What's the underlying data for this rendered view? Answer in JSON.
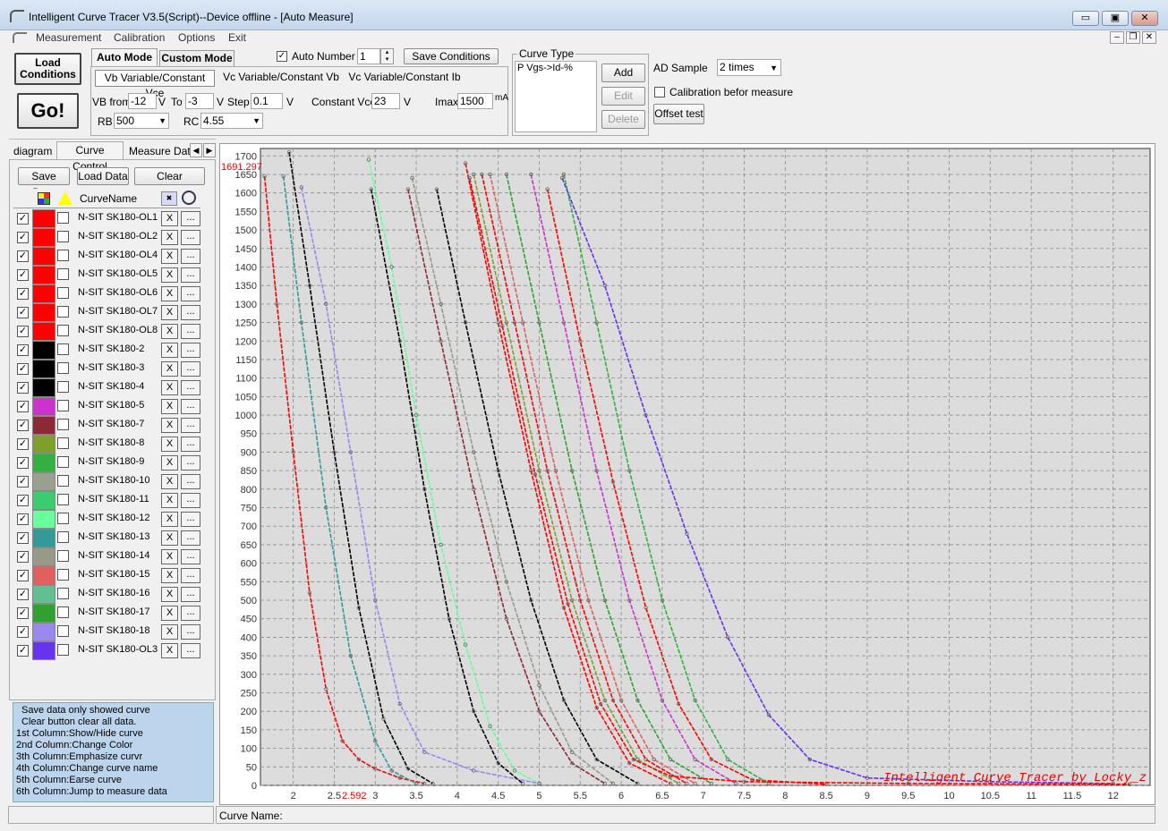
{
  "window": {
    "title": "Intelligent Curve Tracer V3.5(Script)--Device offline - [Auto Measure]",
    "min_label": "▭",
    "max_label": "▣",
    "close_label": "✕"
  },
  "menu": [
    "Measurement",
    "Calibration",
    "Options",
    "Exit"
  ],
  "toolbar": {
    "load_conditions": "Load Conditions",
    "go": "Go!",
    "auto_mode": "Auto Mode",
    "custom_mode": "Custom Mode",
    "auto_number_label": "Auto Number",
    "auto_number_value": "1",
    "save_conditions": "Save Conditions",
    "tabs": [
      "Vb Variable/Constant Vce",
      "Vc Variable/Constant Vb",
      "Vc Variable/Constant Ib"
    ],
    "vb_from_label": "VB from",
    "vb_from": "-12",
    "v1": "V",
    "to_label": "To",
    "to_value": "-3",
    "v2": "V",
    "step_label": "Step",
    "step_value": "0.1",
    "v3": "V",
    "const_vce_label": "Constant Vce",
    "const_vce": "23",
    "v4": "V",
    "imax_label": "Imax",
    "imax": "1500",
    "ma": "mA",
    "rb_label": "RB",
    "rb_value": "500",
    "rc_label": "RC",
    "rc_value": "4.55"
  },
  "curve_type": {
    "legend": "Curve Type",
    "item": "P Vgs->Id-%",
    "add": "Add",
    "edit": "Edit",
    "delete": "Delete"
  },
  "ad": {
    "label": "AD Sample",
    "value": "2 times",
    "calib_label": "Calibration befor measure",
    "offset_test": "Offset test"
  },
  "left_tabs": [
    "diagram",
    "Curve Control",
    "Measure Data"
  ],
  "left_buttons": {
    "save": "Save Data",
    "load": "Load Data",
    "clear": "Clear"
  },
  "table_header": {
    "name": "CurveName"
  },
  "curves": [
    {
      "name": "N-SIT SK180-OL1",
      "color": "#ff0000"
    },
    {
      "name": "N-SIT SK180-OL2",
      "color": "#ff0000"
    },
    {
      "name": "N-SIT SK180-OL4",
      "color": "#ff0000"
    },
    {
      "name": "N-SIT SK180-OL5",
      "color": "#ff0000"
    },
    {
      "name": "N-SIT SK180-OL6",
      "color": "#ff0000"
    },
    {
      "name": "N-SIT SK180-OL7",
      "color": "#ff0000"
    },
    {
      "name": "N-SIT SK180-OL8",
      "color": "#ff0000"
    },
    {
      "name": "N-SIT SK180-2",
      "color": "#000000"
    },
    {
      "name": "N-SIT SK180-3",
      "color": "#000000"
    },
    {
      "name": "N-SIT SK180-4",
      "color": "#000000"
    },
    {
      "name": "N-SIT SK180-5",
      "color": "#cc33cc"
    },
    {
      "name": "N-SIT SK180-7",
      "color": "#8b2a34"
    },
    {
      "name": "N-SIT SK180-8",
      "color": "#7ea02a"
    },
    {
      "name": "N-SIT SK180-9",
      "color": "#33b040"
    },
    {
      "name": "N-SIT SK180-10",
      "color": "#9aa08e"
    },
    {
      "name": "N-SIT SK180-11",
      "color": "#3ccc70"
    },
    {
      "name": "N-SIT SK180-12",
      "color": "#66ff99"
    },
    {
      "name": "N-SIT SK180-13",
      "color": "#339999"
    },
    {
      "name": "N-SIT SK180-14",
      "color": "#999988"
    },
    {
      "name": "N-SIT SK180-15",
      "color": "#e06060"
    },
    {
      "name": "N-SIT SK180-16",
      "color": "#60c090"
    },
    {
      "name": "N-SIT SK180-17",
      "color": "#30a030"
    },
    {
      "name": "N-SIT SK180-18",
      "color": "#9988ee"
    },
    {
      "name": "N-SIT SK180-OL3",
      "color": "#6633ee"
    }
  ],
  "row_x": "X",
  "row_jump": "...",
  "help": [
    "Save data only showed curve",
    "Clear button clear all data.",
    "1st Column:Show/Hide curve",
    "2nd Column:Change Color",
    "3th Column:Emphasize curvr",
    "4th Column:Change curve name",
    "5th Column:Earse curve",
    "6th Column:Jump to measure data"
  ],
  "status": {
    "curve_name_label": "Curve Name:"
  },
  "chart_data": {
    "type": "line",
    "xlim": [
      1.6,
      12.45
    ],
    "ylim": [
      0,
      1720
    ],
    "xticks": [
      2,
      2.5,
      3,
      3.5,
      4,
      4.5,
      5,
      5.5,
      6,
      6.5,
      7,
      7.5,
      8,
      8.5,
      9,
      9.5,
      10,
      10.5,
      11,
      11.5,
      12
    ],
    "yticks": [
      0,
      50,
      100,
      150,
      200,
      250,
      300,
      350,
      400,
      450,
      500,
      550,
      600,
      650,
      700,
      750,
      800,
      850,
      900,
      950,
      1000,
      1050,
      1100,
      1150,
      1200,
      1250,
      1300,
      1350,
      1400,
      1450,
      1500,
      1550,
      1600,
      1650,
      1700
    ],
    "cursor_y_label": "1691.297",
    "cursor_x_label": "2.592",
    "watermark": "Intelligent Curve Tracer by Locky_z",
    "grid": true,
    "series": [
      {
        "color": "#ff0000",
        "x": [
          1.65,
          1.8,
          2.0,
          2.2,
          2.4,
          2.6,
          2.8,
          3.0,
          3.3,
          3.6
        ],
        "y": [
          1645,
          1300,
          900,
          520,
          260,
          120,
          70,
          45,
          20,
          5
        ]
      },
      {
        "color": "#339999",
        "x": [
          1.88,
          2.1,
          2.4,
          2.7,
          3.0,
          3.2,
          3.5
        ],
        "y": [
          1645,
          1250,
          750,
          350,
          120,
          40,
          5
        ]
      },
      {
        "color": "#000000",
        "x": [
          1.95,
          2.2,
          2.5,
          2.8,
          3.1,
          3.4,
          3.7
        ],
        "y": [
          1710,
          1350,
          900,
          480,
          180,
          45,
          5
        ]
      },
      {
        "color": "#9988ee",
        "x": [
          2.1,
          2.4,
          2.7,
          3.0,
          3.3,
          3.6,
          4.2,
          5.0
        ],
        "y": [
          1615,
          1300,
          900,
          500,
          220,
          90,
          40,
          5
        ]
      },
      {
        "color": "#000000",
        "x": [
          2.95,
          3.3,
          3.6,
          3.9,
          4.2,
          4.5,
          4.8
        ],
        "y": [
          1610,
          1200,
          800,
          450,
          200,
          60,
          5
        ]
      },
      {
        "color": "#66ff99",
        "x": [
          2.92,
          3.2,
          3.5,
          3.8,
          4.1,
          4.4,
          4.7,
          5.0
        ],
        "y": [
          1690,
          1400,
          1000,
          650,
          380,
          160,
          40,
          5
        ]
      },
      {
        "color": "#8b2a34",
        "x": [
          3.4,
          3.8,
          4.2,
          4.6,
          5.0,
          5.4,
          5.8
        ],
        "y": [
          1610,
          1200,
          800,
          450,
          200,
          60,
          5
        ]
      },
      {
        "color": "#999988",
        "x": [
          3.45,
          3.8,
          4.2,
          4.6,
          5.0,
          5.4,
          5.9
        ],
        "y": [
          1640,
          1300,
          900,
          550,
          270,
          90,
          5
        ]
      },
      {
        "color": "#000000",
        "x": [
          3.75,
          4.1,
          4.5,
          4.9,
          5.3,
          5.7,
          6.2
        ],
        "y": [
          1610,
          1250,
          850,
          500,
          230,
          70,
          5
        ]
      },
      {
        "color": "#ff0000",
        "x": [
          4.1,
          4.5,
          4.9,
          5.3,
          5.7,
          6.1,
          6.6
        ],
        "y": [
          1680,
          1250,
          850,
          480,
          210,
          60,
          5
        ]
      },
      {
        "color": "#7ea02a",
        "x": [
          4.2,
          4.6,
          5.0,
          5.4,
          5.8,
          6.2,
          6.7
        ],
        "y": [
          1650,
          1250,
          850,
          500,
          230,
          70,
          5
        ]
      },
      {
        "color": "#ff0000",
        "x": [
          4.3,
          4.7,
          5.1,
          5.5,
          5.9,
          6.3,
          6.8
        ],
        "y": [
          1650,
          1250,
          850,
          500,
          230,
          70,
          5
        ]
      },
      {
        "color": "#e06060",
        "x": [
          4.4,
          4.8,
          5.2,
          5.6,
          6.0,
          6.4,
          6.9
        ],
        "y": [
          1650,
          1250,
          850,
          500,
          230,
          70,
          5
        ]
      },
      {
        "color": "#30a030",
        "x": [
          4.6,
          5.0,
          5.4,
          5.8,
          6.2,
          6.6,
          7.1
        ],
        "y": [
          1650,
          1250,
          850,
          500,
          230,
          70,
          5
        ]
      },
      {
        "color": "#cc33cc",
        "x": [
          4.9,
          5.3,
          5.7,
          6.1,
          6.5,
          6.9,
          7.4
        ],
        "y": [
          1650,
          1250,
          850,
          500,
          230,
          70,
          5
        ]
      },
      {
        "color": "#ff0000",
        "x": [
          5.1,
          5.5,
          5.9,
          6.3,
          6.7,
          7.1,
          7.6,
          8.5
        ],
        "y": [
          1610,
          1200,
          820,
          480,
          220,
          70,
          15,
          3
        ]
      },
      {
        "color": "#33b040",
        "x": [
          5.3,
          5.7,
          6.1,
          6.5,
          6.9,
          7.3,
          7.8
        ],
        "y": [
          1650,
          1250,
          850,
          500,
          230,
          70,
          5
        ]
      },
      {
        "color": "#6633ee",
        "x": [
          5.28,
          5.8,
          6.3,
          6.8,
          7.3,
          7.8,
          8.3,
          9.0,
          10.5,
          12.0
        ],
        "y": [
          1640,
          1350,
          1000,
          680,
          400,
          190,
          70,
          20,
          10,
          5
        ]
      },
      {
        "color": "#ff0000",
        "x": [
          4.15,
          4.55,
          4.95,
          5.35,
          5.75,
          6.15,
          6.6,
          7.5,
          9.5,
          12.2
        ],
        "y": [
          1640,
          1240,
          840,
          490,
          220,
          70,
          25,
          10,
          5,
          3
        ]
      }
    ]
  }
}
